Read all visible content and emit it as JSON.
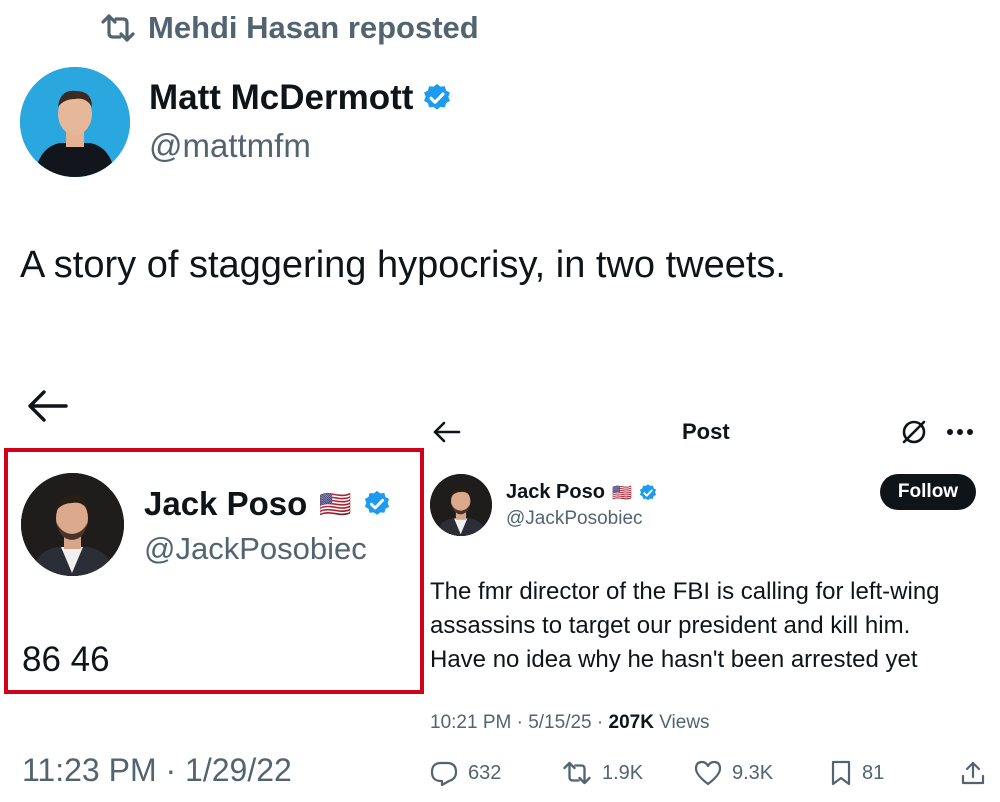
{
  "repost": {
    "label": "Mehdi Hasan reposted",
    "icon": "repost-icon"
  },
  "main_tweet": {
    "author_name": "Matt McDermott",
    "author_handle": "@mattmfm",
    "verified": true,
    "text": "A story of staggering hypocrisy, in two tweets."
  },
  "left_screenshot": {
    "back_icon": "arrow-left-icon",
    "author_name": "Jack Poso",
    "flag": "🇺🇸",
    "author_handle": "@JackPosobiec",
    "text": "86 46",
    "timestamp": "11:23 PM · 1/29/22",
    "highlight_color": "#d0021b"
  },
  "right_screenshot": {
    "header_title": "Post",
    "back_icon": "arrow-left-icon",
    "grok_icon": "slashed-circle-icon",
    "more_icon": "more-icon",
    "author_name": "Jack Poso",
    "flag": "🇺🇸",
    "author_handle": "@JackPosobiec",
    "follow_label": "Follow",
    "text_lines": [
      "The fmr director of the FBI is calling for left-wing",
      "assassins to target our president and kill him.",
      "Have no idea why he hasn't been arrested yet"
    ],
    "meta_time": "10:21 PM · 5/15/25 · ",
    "meta_views_count": "207K",
    "meta_views_label": " Views",
    "stats": {
      "replies": "632",
      "reposts": "1.9K",
      "likes": "9.3K",
      "bookmarks": "81"
    }
  },
  "colors": {
    "verified": "#1d9bf0",
    "muted": "#536471",
    "text": "#0f1419"
  }
}
